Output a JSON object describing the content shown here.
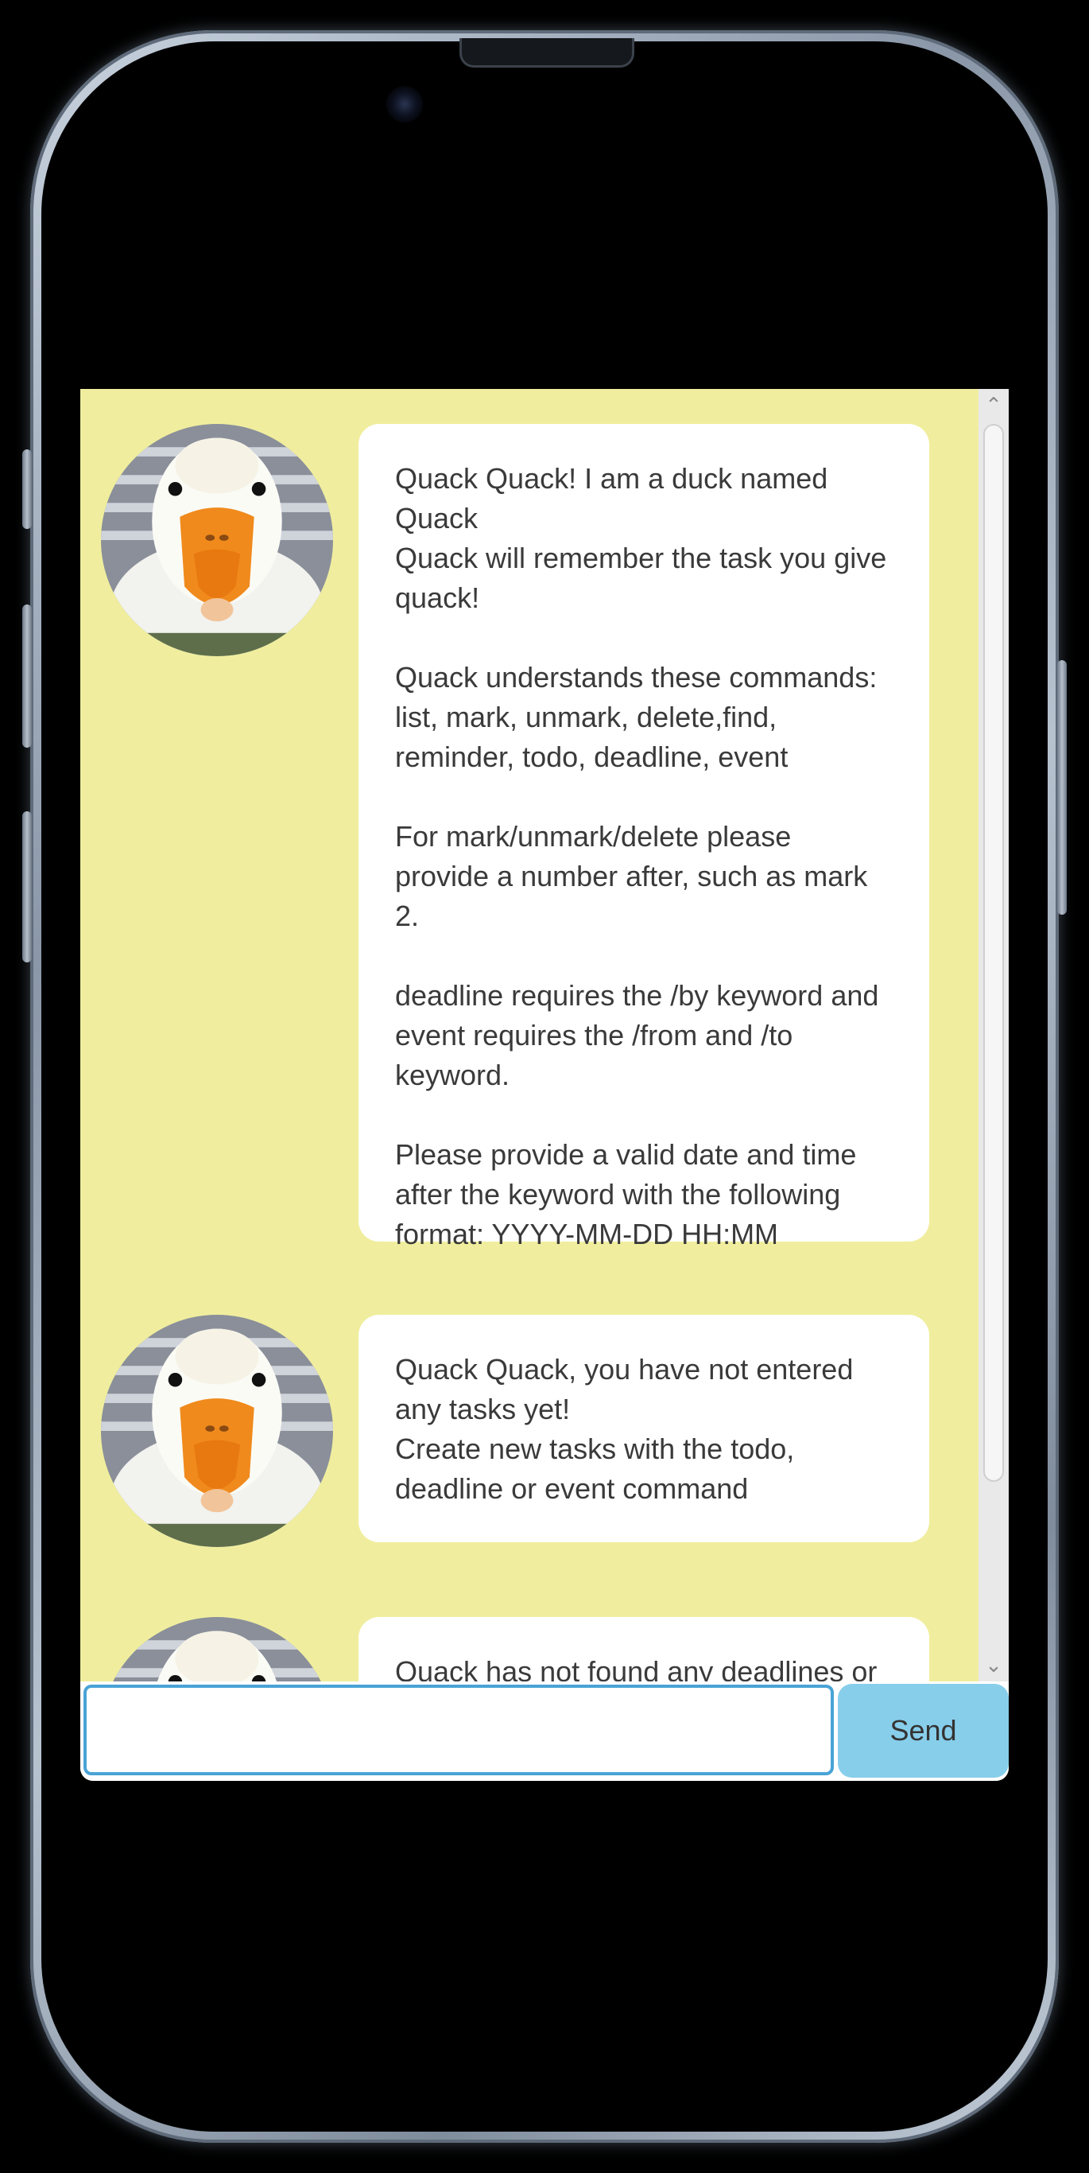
{
  "messages": [
    {
      "sender": "Quack",
      "text": "Quack Quack! I am a duck named Quack\nQuack will remember the task you give quack!\n\nQuack understands these commands: list, mark, unmark, delete,find, reminder, todo, deadline, event\n\nFor mark/unmark/delete please provide a number after, such as mark 2.\n\ndeadline requires the /by keyword and event requires the /from and /to keyword.\n\nPlease provide a valid date and time after the keyword with the following format: YYYY-MM-DD HH:MM"
    },
    {
      "sender": "Quack",
      "text": "Quack Quack, you have not entered any tasks yet!\nCreate new tasks with the todo, deadline or event command"
    },
    {
      "sender": "Quack",
      "text": "Quack has not found any deadlines or"
    }
  ],
  "input": {
    "value": "",
    "placeholder": ""
  },
  "send_button": {
    "label": "Send"
  },
  "scrollbar": {
    "up_glyph": "⌃",
    "down_glyph": "⌄"
  },
  "colors": {
    "chat_background": "#f0ee9e",
    "bubble": "#ffffff",
    "send_button": "#87ceeb",
    "input_border": "#49a3d6"
  }
}
